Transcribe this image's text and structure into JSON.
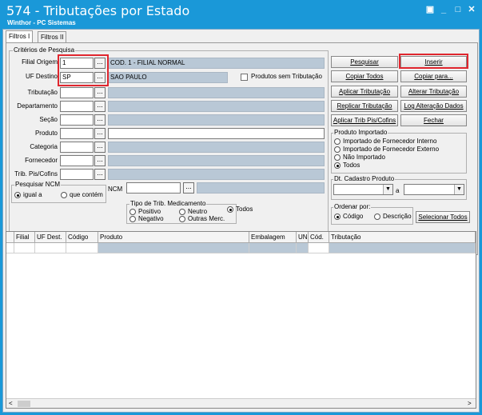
{
  "window": {
    "title": "574 - Tributações por Estado",
    "subtitle": "Winthor - PC Sistemas",
    "controls": {
      "restore": "▣",
      "minimize": "_",
      "maximize": "□",
      "close": "✕"
    }
  },
  "tabs": [
    {
      "label": "Filtros I"
    },
    {
      "label": "Filtros II"
    }
  ],
  "criteria": {
    "group_title": "Critérios de Pesquisa",
    "fields": [
      {
        "label": "Filial Origem",
        "value": "1",
        "desc": "COD. 1 - FILIAL NORMAL"
      },
      {
        "label": "UF Destino",
        "value": "SP",
        "desc": "SAO PAULO"
      },
      {
        "label": "Tributação",
        "value": "",
        "desc": ""
      },
      {
        "label": "Departamento",
        "value": "",
        "desc": ""
      },
      {
        "label": "Seção",
        "value": "",
        "desc": ""
      },
      {
        "label": "Produto",
        "value": "",
        "desc": ""
      },
      {
        "label": "Categoria",
        "value": "",
        "desc": ""
      },
      {
        "label": "Fornecedor",
        "value": "",
        "desc": ""
      },
      {
        "label": "Trib. Pis/Cofins",
        "value": "",
        "desc": ""
      }
    ],
    "dots_label": "...",
    "no_trib_label": "Produtos sem Tributação",
    "ncm_group_title": "Pesquisar NCM",
    "ncm_equal": "igual a",
    "ncm_contains": "que contém",
    "ncm_label": "NCM",
    "ncm_value": "",
    "medicine_title": "Tipo de Trib. Medicamento",
    "medicine_options": [
      "Positivo",
      "Neutro",
      "Todos",
      "Negativo",
      "Outras Merc."
    ]
  },
  "buttons": {
    "pesquisar": "Pesquisar",
    "inserir": "Inserir",
    "copiar_todos": "Copiar Todos",
    "copiar_para": "Copiar para...",
    "aplicar_trib": "Aplicar Tributação",
    "alterar_trib": "Alterar Tributação",
    "replicar_trib": "Replicar Tributação",
    "log_alteracao": "Log Alteração Dados",
    "aplicar_pis": "Aplicar Trib Pis/Cofins",
    "fechar": "Fechar",
    "selecionar_todos": "Selecionar Todos"
  },
  "imported": {
    "title": "Produto Importado",
    "options": [
      "Importado de Fornecedor Interno",
      "Importado de Fornecedor Externo",
      "Não Importado",
      "Todos"
    ]
  },
  "dt_cadastro": {
    "title": "Dt. Cadastro Produto",
    "sep": "a"
  },
  "order": {
    "title": "Ordenar por:",
    "options": [
      "Código",
      "Descrição"
    ]
  },
  "grid": {
    "columns": [
      "Filial",
      "UF Dest.",
      "Código",
      "Produto",
      "Embalagem",
      "UN",
      "Cód.",
      "Tributação"
    ],
    "scroll_left": "<",
    "scroll_right": ">"
  }
}
